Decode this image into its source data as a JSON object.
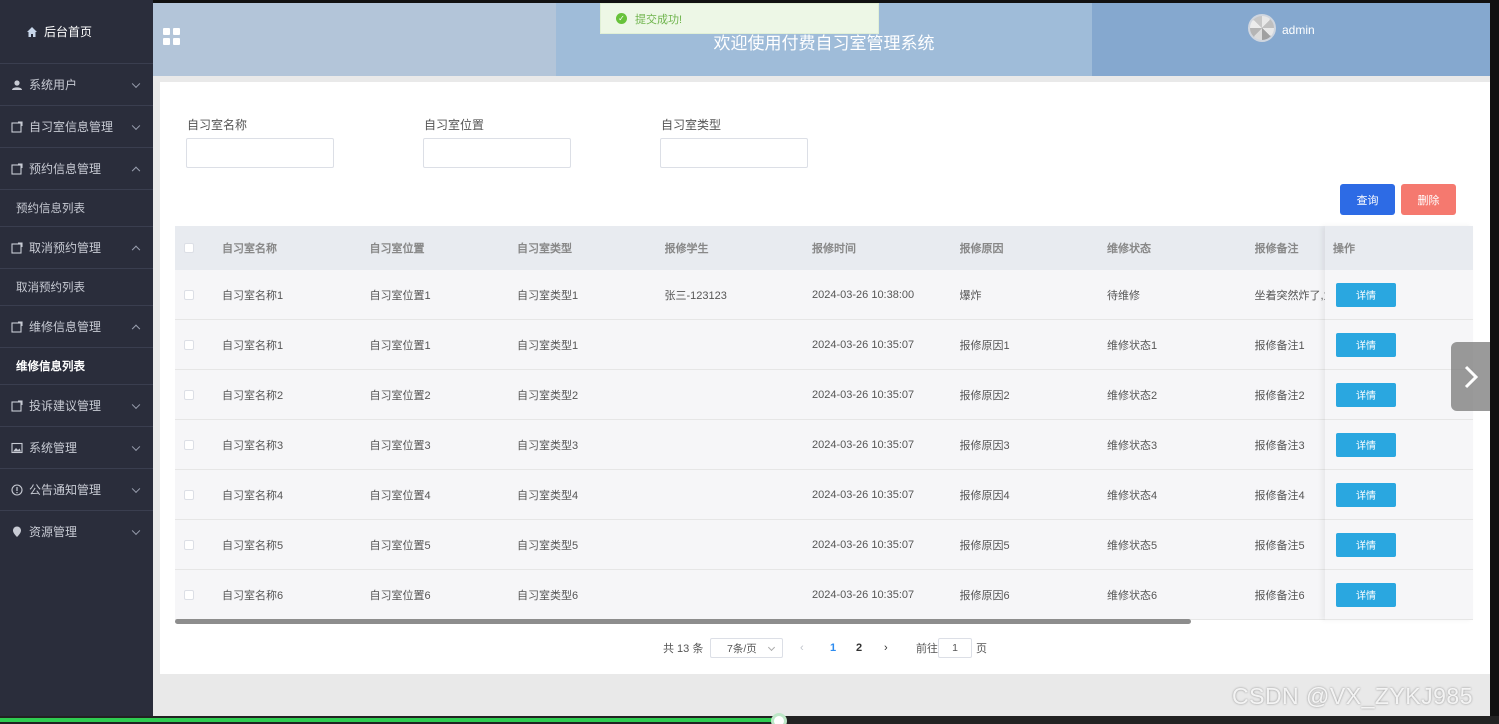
{
  "sidebar": {
    "home": "后台首页",
    "menus": [
      {
        "label": "系统用户",
        "expanded": false,
        "icon": "user-icon"
      },
      {
        "label": "自习室信息管理",
        "expanded": false,
        "icon": "folder-icon"
      },
      {
        "label": "预约信息管理",
        "expanded": true,
        "icon": "folder-icon",
        "sub": "预约信息列表"
      },
      {
        "label": "取消预约管理",
        "expanded": true,
        "icon": "folder-icon",
        "sub": "取消预约列表"
      },
      {
        "label": "维修信息管理",
        "expanded": true,
        "icon": "folder-icon",
        "sub": "维修信息列表"
      },
      {
        "label": "投诉建议管理",
        "expanded": false,
        "icon": "folder-icon"
      },
      {
        "label": "系统管理",
        "expanded": false,
        "icon": "image-icon"
      },
      {
        "label": "公告通知管理",
        "expanded": false,
        "icon": "info-icon"
      },
      {
        "label": "资源管理",
        "expanded": false,
        "icon": "location-icon"
      }
    ]
  },
  "header": {
    "title": "欢迎使用付费自习室管理系统",
    "username": "admin"
  },
  "toast": {
    "message": "提交成功!"
  },
  "filters": {
    "name_label": "自习室名称",
    "location_label": "自习室位置",
    "type_label": "自习室类型",
    "name_value": "",
    "location_value": "",
    "type_value": ""
  },
  "buttons": {
    "query": "查询",
    "delete": "删除",
    "detail": "详情"
  },
  "table": {
    "columns": [
      "自习室名称",
      "自习室位置",
      "自习室类型",
      "报修学生",
      "报修时间",
      "报修原因",
      "维修状态",
      "报修备注",
      "操作"
    ],
    "rows": [
      [
        "自习室名称1",
        "自习室位置1",
        "自习室类型1",
        "张三-123123",
        "2024-03-26 10:38:00",
        "爆炸",
        "待维修",
        "坐着突然炸了,为爆"
      ],
      [
        "自习室名称1",
        "自习室位置1",
        "自习室类型1",
        "",
        "2024-03-26 10:35:07",
        "报修原因1",
        "维修状态1",
        "报修备注1"
      ],
      [
        "自习室名称2",
        "自习室位置2",
        "自习室类型2",
        "",
        "2024-03-26 10:35:07",
        "报修原因2",
        "维修状态2",
        "报修备注2"
      ],
      [
        "自习室名称3",
        "自习室位置3",
        "自习室类型3",
        "",
        "2024-03-26 10:35:07",
        "报修原因3",
        "维修状态3",
        "报修备注3"
      ],
      [
        "自习室名称4",
        "自习室位置4",
        "自习室类型4",
        "",
        "2024-03-26 10:35:07",
        "报修原因4",
        "维修状态4",
        "报修备注4"
      ],
      [
        "自习室名称5",
        "自习室位置5",
        "自习室类型5",
        "",
        "2024-03-26 10:35:07",
        "报修原因5",
        "维修状态5",
        "报修备注5"
      ],
      [
        "自习室名称6",
        "自习室位置6",
        "自习室类型6",
        "",
        "2024-03-26 10:35:07",
        "报修原因6",
        "维修状态6",
        "报修备注6"
      ]
    ]
  },
  "pagination": {
    "total": "共 13 条",
    "page_size": "7条/页",
    "pages": [
      "1",
      "2"
    ],
    "current_page": "1",
    "goto_label": "前往",
    "goto_value": "1",
    "page_suffix": "页"
  },
  "video": {
    "progress": 0.52
  },
  "watermark": "CSDN @VX_ZYKJ985",
  "colors": {
    "sidebar_bg": "#2a2d3b",
    "query_btn": "#2d6be5",
    "delete_btn": "#f5796f",
    "detail_btn": "#2aa7e0",
    "success": "#67c23a"
  }
}
